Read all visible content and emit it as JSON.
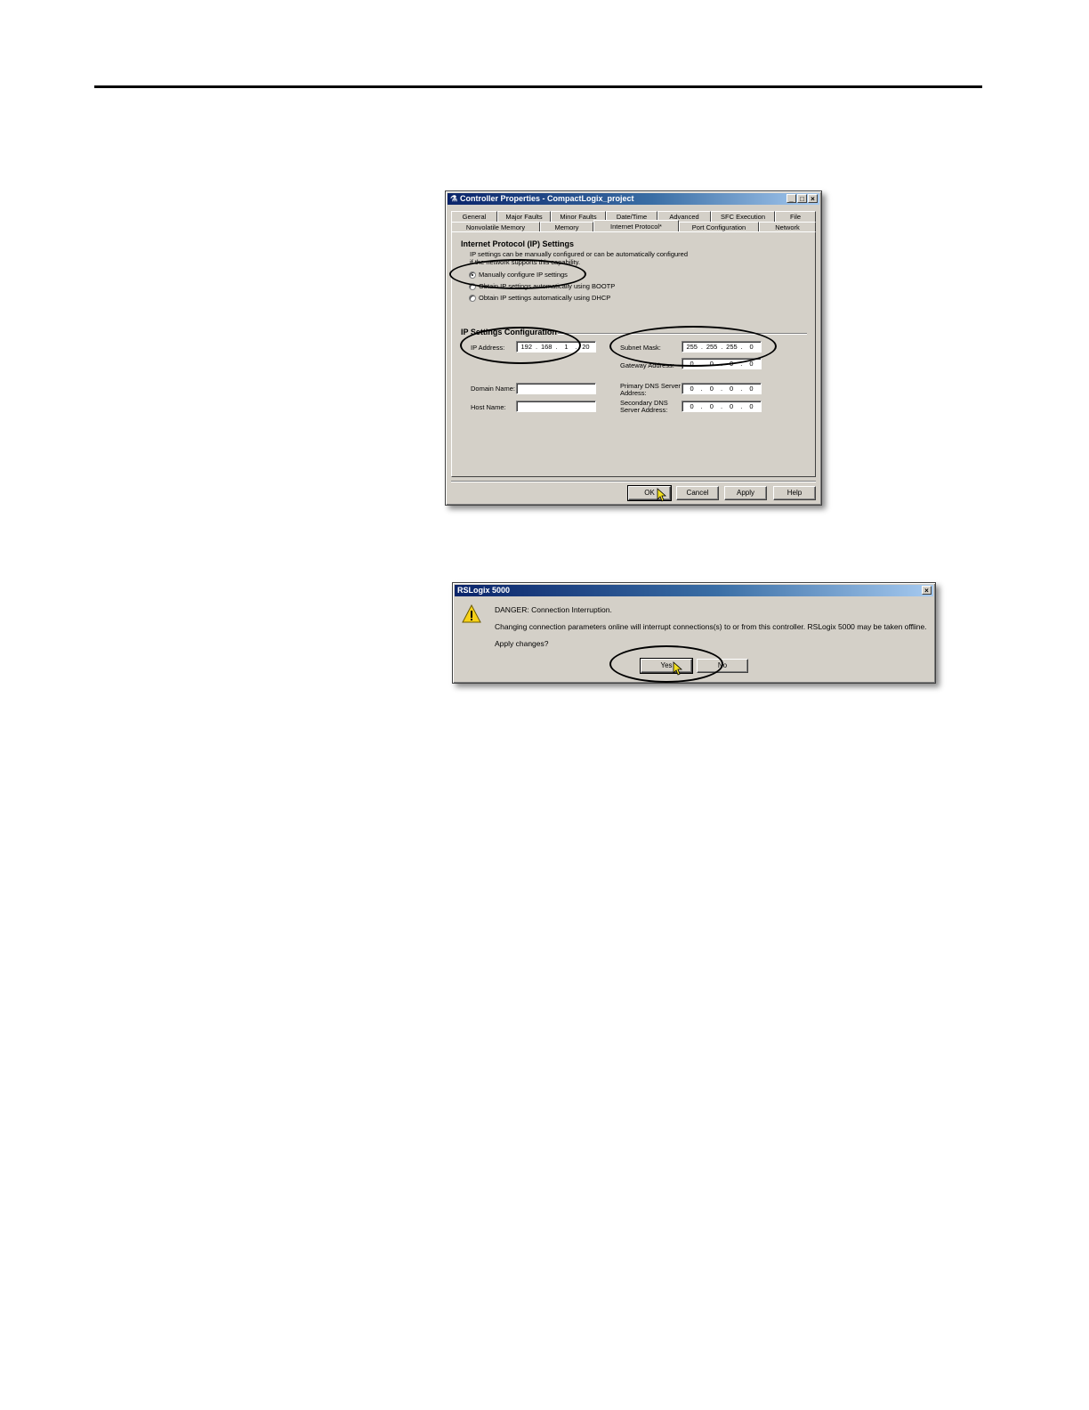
{
  "dialog1": {
    "title": "Controller Properties - CompactLogix_project",
    "tabs_row1": [
      "General",
      "Major Faults",
      "Minor Faults",
      "Date/Time",
      "Advanced",
      "SFC Execution",
      "File"
    ],
    "tabs_row2": [
      "Nonvolatile Memory",
      "Memory",
      "Internet Protocol*",
      "Port Configuration",
      "Network"
    ],
    "ip_section_title": "Internet Protocol (IP) Settings",
    "ip_desc_line1": "IP settings can be manually configured or can be automatically configured",
    "ip_desc_line2": "if the network supports this capability.",
    "radio_manual": "Manually configure IP settings",
    "radio_bootp": "Obtain IP settings automatically using BOOTP",
    "radio_dhcp": "Obtain IP settings automatically using DHCP",
    "config_title": "IP Settings Configuration",
    "ip_address_label": "IP Address:",
    "ip_address": [
      "192",
      "168",
      "1",
      "20"
    ],
    "subnet_label": "Subnet Mask:",
    "subnet": [
      "255",
      "255",
      "255",
      "0"
    ],
    "gateway_label": "Gateway Address:",
    "gateway": [
      "0",
      "0",
      "0",
      "0"
    ],
    "domain_label": "Domain Name:",
    "host_label": "Host Name:",
    "dns1_label_1": "Primary DNS Server",
    "dns1_label_2": "Address:",
    "dns1": [
      "0",
      "0",
      "0",
      "0"
    ],
    "dns2_label_1": "Secondary DNS",
    "dns2_label_2": "Server Address:",
    "dns2": [
      "0",
      "0",
      "0",
      "0"
    ],
    "btn_ok": "OK",
    "btn_cancel": "Cancel",
    "btn_apply": "Apply",
    "btn_help": "Help"
  },
  "dialog2": {
    "title": "RSLogix 5000",
    "line1": "DANGER: Connection Interruption.",
    "line2": "Changing connection parameters online will interrupt connections(s) to or from this controller.  RSLogix 5000 may be taken offline.",
    "line3": "Apply changes?",
    "btn_yes": "Yes",
    "btn_no": "No"
  }
}
